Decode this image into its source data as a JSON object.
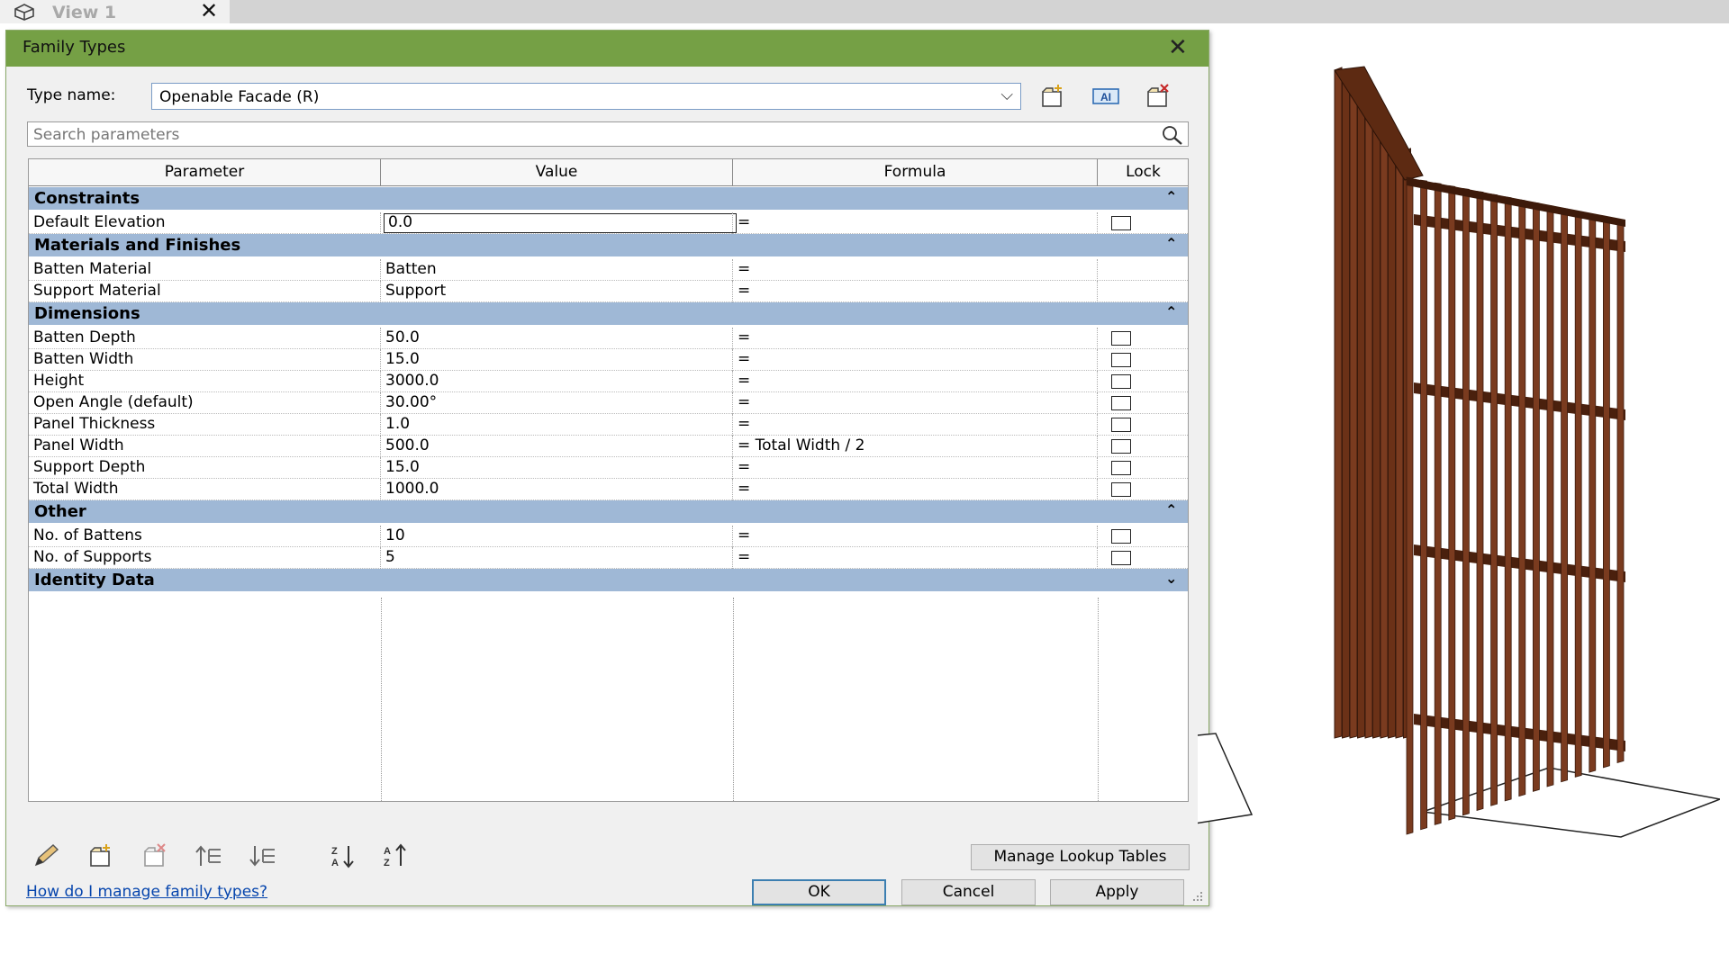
{
  "view_tab": {
    "label": "View 1"
  },
  "dialog": {
    "title": "Family Types",
    "type_name_label": "Type name:",
    "type_name_value": "Openable Facade (R)",
    "search_placeholder": "Search parameters",
    "columns": [
      "Parameter",
      "Value",
      "Formula",
      "Lock"
    ],
    "groups": [
      {
        "label": "Constraints",
        "collapse": "⌃",
        "rows": [
          {
            "parameter": "Default Elevation",
            "value": "0.0",
            "formula": "=",
            "lock": true,
            "editing": true
          }
        ]
      },
      {
        "label": "Materials and Finishes",
        "collapse": "⌃",
        "rows": [
          {
            "parameter": "Batten Material",
            "value": "Batten",
            "formula": "=",
            "lock": false
          },
          {
            "parameter": "Support Material",
            "value": "Support",
            "formula": "=",
            "lock": false
          }
        ]
      },
      {
        "label": "Dimensions",
        "collapse": "⌃",
        "rows": [
          {
            "parameter": "Batten Depth",
            "value": "50.0",
            "formula": "=",
            "lock": true
          },
          {
            "parameter": "Batten Width",
            "value": "15.0",
            "formula": "=",
            "lock": true
          },
          {
            "parameter": "Height",
            "value": "3000.0",
            "formula": "=",
            "lock": true
          },
          {
            "parameter": "Open Angle (default)",
            "value": "30.00°",
            "formula": "=",
            "lock": true
          },
          {
            "parameter": "Panel Thickness",
            "value": "1.0",
            "formula": "=",
            "lock": true
          },
          {
            "parameter": "Panel Width",
            "value": "500.0",
            "formula": "= Total Width / 2",
            "lock": true
          },
          {
            "parameter": "Support Depth",
            "value": "15.0",
            "formula": "=",
            "lock": true
          },
          {
            "parameter": "Total Width",
            "value": "1000.0",
            "formula": "=",
            "lock": true
          }
        ]
      },
      {
        "label": "Other",
        "collapse": "⌃",
        "rows": [
          {
            "parameter": "No. of Battens",
            "value": "10",
            "formula": "=",
            "lock": true
          },
          {
            "parameter": "No. of Supports",
            "value": "5",
            "formula": "=",
            "lock": true
          }
        ]
      },
      {
        "label": "Identity Data",
        "collapse": "⌄",
        "rows": []
      }
    ],
    "manage_lookup_label": "Manage Lookup Tables",
    "help_link": "How do I manage family types?",
    "ok_label": "OK",
    "cancel_label": "Cancel",
    "apply_label": "Apply",
    "colors": {
      "title_bar": "#75a045",
      "group_header": "#9fb8d6",
      "link": "#0645ad",
      "batten": "#7a3b1f"
    }
  }
}
